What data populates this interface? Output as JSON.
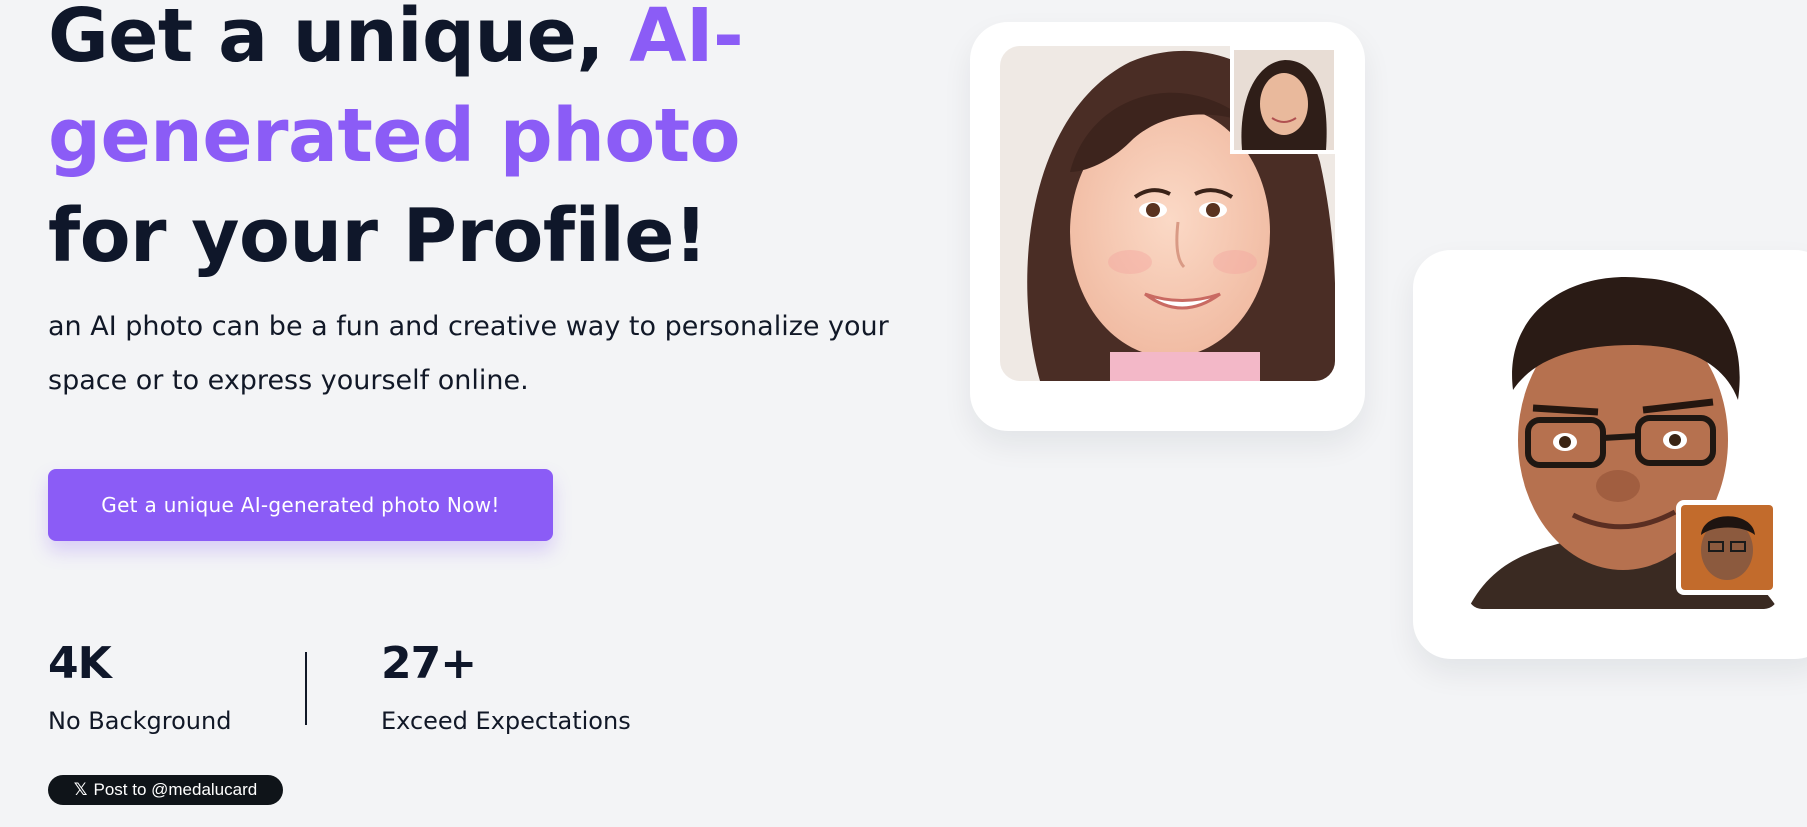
{
  "hero": {
    "title_part1": "Get a unique, ",
    "title_accent": "AI-generated photo",
    "title_part2": " for your Profile!",
    "subtitle": "an AI photo can be a fun and creative way to personalize your space or to express yourself online.",
    "cta_label": "Get a unique AI-generated photo Now!"
  },
  "stats": [
    {
      "value": "4K",
      "label": "No Background"
    },
    {
      "value": "27+",
      "label": "Exceed Expectations"
    }
  ],
  "share": {
    "label": "Post to @medalucard",
    "icon": "x-logo-icon"
  },
  "colors": {
    "accent": "#8b5cf6",
    "heading": "#0f172a",
    "background": "#f3f4f6",
    "card": "#ffffff"
  }
}
